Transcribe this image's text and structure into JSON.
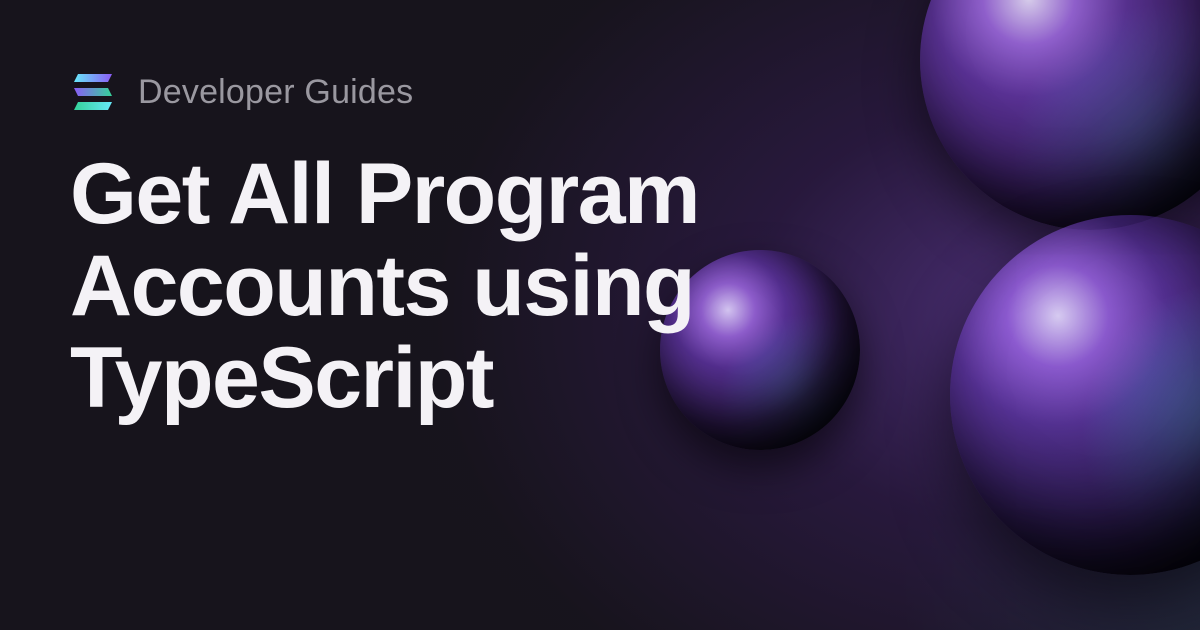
{
  "brand": {
    "eyebrow": "Developer Guides",
    "logo_name": "solana-logo",
    "logo_colors": {
      "top": "#67e8f9",
      "mid": "#8b5cf6",
      "bottom": "#34d399"
    }
  },
  "page": {
    "title": "Get All Program Accounts using TypeScript"
  },
  "theme": {
    "background": "#17141c",
    "text_primary": "#f4f2f6",
    "text_muted": "#9a98a0",
    "accent_purple": "#7c3aed",
    "accent_teal": "#2dd4bf"
  }
}
